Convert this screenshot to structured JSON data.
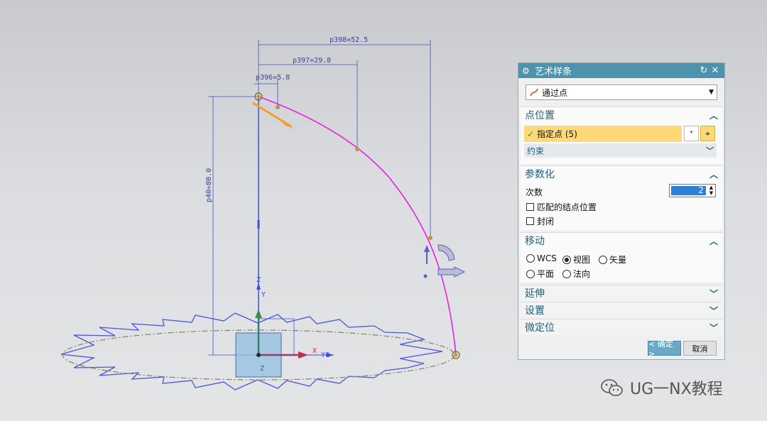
{
  "viewport": {
    "dimensions": [
      "p398=52.5",
      "p397=29.8",
      "p396=5.8",
      "p40=80.0"
    ],
    "axis_labels": {
      "x": "X",
      "y": "Y",
      "z": "Z",
      "zc": "ZC",
      "yc": "YC"
    }
  },
  "dialog": {
    "title": "艺术样条",
    "type_combo": "通过点",
    "sections": {
      "point_position": {
        "title": "点位置",
        "specify_point": "指定点 (5)",
        "constraint": "约束"
      },
      "parameterization": {
        "title": "参数化",
        "degree_label": "次数",
        "degree_value": "2",
        "match_knots": "匹配的结点位置",
        "closed": "封闭"
      },
      "move": {
        "title": "移动",
        "options": [
          "WCS",
          "视图",
          "矢量",
          "平面",
          "法向"
        ],
        "selected": "视图"
      },
      "extend": {
        "title": "延伸"
      },
      "settings": {
        "title": "设置"
      },
      "fine_position": {
        "title": "微定位"
      }
    },
    "buttons": {
      "ok": "< 确定 >",
      "cancel": "取消"
    }
  },
  "watermark": "UG一NX教程",
  "colors": {
    "title_bar": "#4d93ad",
    "selection": "#ffd978",
    "spline": "#e61ee6",
    "sketch": "#3a4fe0"
  }
}
